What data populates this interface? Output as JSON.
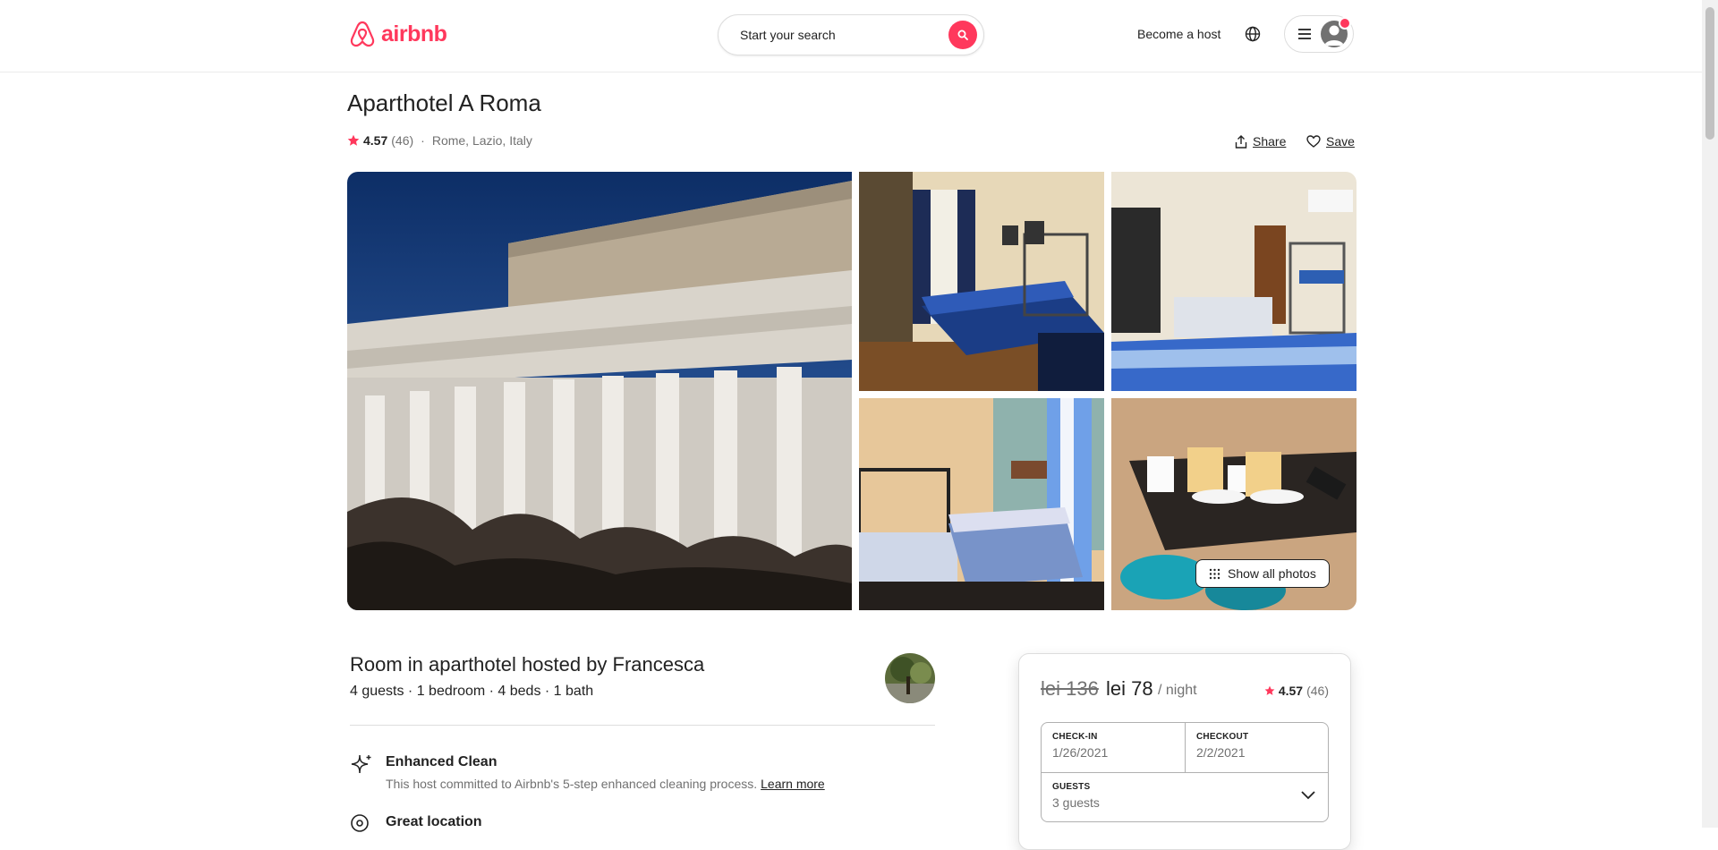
{
  "header": {
    "brand": "airbnb",
    "search_placeholder": "Start your search",
    "become_host": "Become a host",
    "icons": [
      "airbnb-logo-icon",
      "search-icon",
      "globe-icon",
      "hamburger-icon",
      "user-avatar-icon"
    ],
    "brand_color": "#FF385C"
  },
  "listing": {
    "title": "Aparthotel A Roma",
    "rating": "4.57",
    "reviews": "(46)",
    "separator": "·",
    "location": "Rome, Lazio, Italy",
    "share_label": "Share",
    "save_label": "Save"
  },
  "gallery": {
    "show_all_label": "Show all photos"
  },
  "host": {
    "title": "Room in aparthotel hosted by Francesca",
    "subtitle": "4 guests · 1 bedroom · 4 beds · 1 bath"
  },
  "features": [
    {
      "title": "Enhanced Clean",
      "desc": "This host committed to Airbnb's 5-step enhanced cleaning process.",
      "link": "Learn more"
    },
    {
      "title": "Great location"
    }
  ],
  "booking": {
    "old_price": "lei 136",
    "price": "lei 78",
    "per_night": "/ night",
    "rating": "4.57",
    "reviews": "(46)",
    "checkin_label": "CHECK-IN",
    "checkin_value": "1/26/2021",
    "checkout_label": "CHECKOUT",
    "checkout_value": "2/2/2021",
    "guests_label": "GUESTS",
    "guests_value": "3 guests"
  }
}
